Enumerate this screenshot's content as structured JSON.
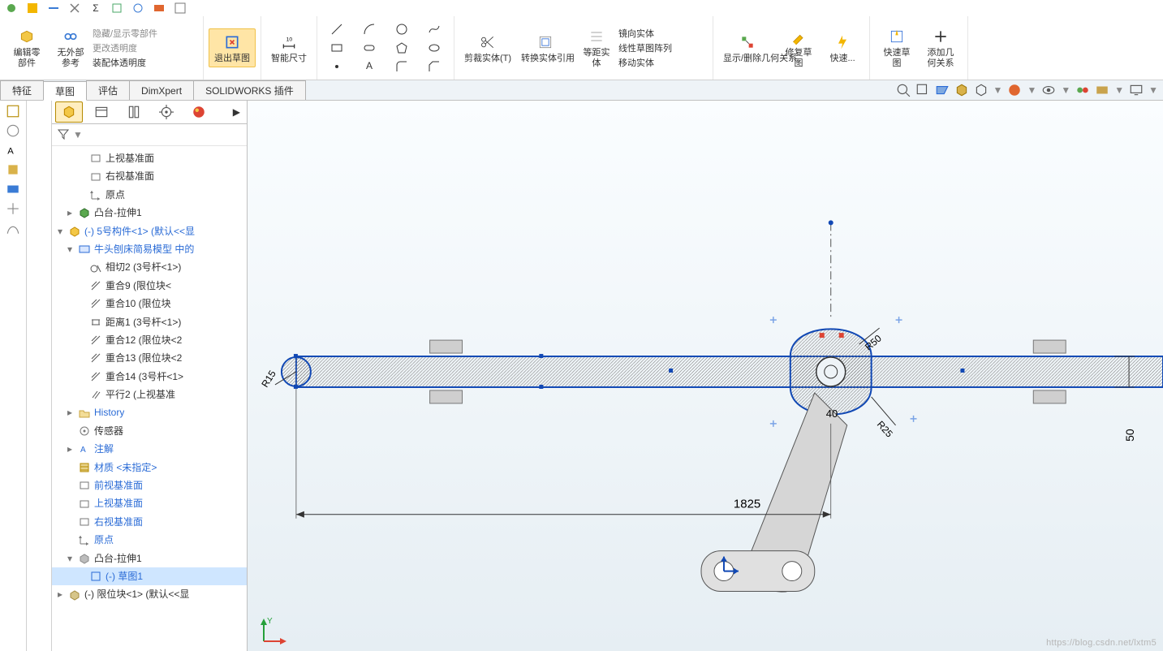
{
  "quickbar": {
    "icons": [
      "save",
      "undo",
      "redo",
      "rebuild",
      "options",
      "measure",
      "sigma",
      "capture",
      "layers",
      "cube",
      "link",
      "help"
    ]
  },
  "ribbon": {
    "edit_part_icon": "cube-edit",
    "edit_part": "编辑零\n部件",
    "ext_ref": "无外部\n参考",
    "row1": "隐藏/显示零部件",
    "row2": "更改透明度",
    "row3": "装配体透明度",
    "exit_sketch": "退出草图",
    "smart_dim": "智能尺寸",
    "trim": "剪裁实体(T)",
    "convert": "转换实体引用",
    "offset": "等距实\n体",
    "mirror": "镜向实体",
    "pattern": "线性草图阵列",
    "move": "移动实体",
    "relations": "显示/删除几何关系",
    "repair": "修复草\n图",
    "quick": "快速...",
    "quick_sketch": "快速草\n图",
    "add_relation": "添加几\n何关系"
  },
  "tabs": [
    "特征",
    "草图",
    "评估",
    "DimXpert",
    "SOLIDWORKS 插件"
  ],
  "hud_icons": [
    "zoom-fit",
    "zoom-area",
    "section",
    "view-cube",
    "orient",
    "appearance",
    "dd1",
    "hide-show",
    "render",
    "dd2",
    "display"
  ],
  "fp_tabs": [
    "assembly",
    "config",
    "display",
    "appearance",
    "render"
  ],
  "tree": [
    {
      "ind": 2,
      "icon": "plane",
      "label": "上视基准面",
      "blue": false
    },
    {
      "ind": 2,
      "icon": "plane",
      "label": "右视基准面",
      "blue": false
    },
    {
      "ind": 2,
      "icon": "origin",
      "label": "原点",
      "blue": false
    },
    {
      "ind": 1,
      "tw": "▸",
      "icon": "extrude",
      "label": "凸台-拉伸1",
      "blue": false
    },
    {
      "ind": 0,
      "tw": "▾",
      "icon": "part",
      "label": "(-) 5号构件<1> (默认<<显",
      "blue": true
    },
    {
      "ind": 1,
      "tw": "▾",
      "icon": "mates",
      "label": "牛头刨床简易模型 中的",
      "blue": true
    },
    {
      "ind": 2,
      "icon": "tangent",
      "label": "相切2 (3号杆<1>)",
      "blue": false
    },
    {
      "ind": 2,
      "icon": "coinc",
      "label": "重合9 (限位块<",
      "blue": false
    },
    {
      "ind": 2,
      "icon": "coinc",
      "label": "重合10 (限位块",
      "blue": false
    },
    {
      "ind": 2,
      "icon": "dist",
      "label": "距离1 (3号杆<1>)",
      "blue": false
    },
    {
      "ind": 2,
      "icon": "coinc",
      "label": "重合12 (限位块<2",
      "blue": false
    },
    {
      "ind": 2,
      "icon": "coinc",
      "label": "重合13 (限位块<2",
      "blue": false
    },
    {
      "ind": 2,
      "icon": "coinc",
      "label": "重合14 (3号杆<1>",
      "blue": false
    },
    {
      "ind": 2,
      "icon": "parallel",
      "label": "平行2 (上视基准",
      "blue": false
    },
    {
      "ind": 1,
      "tw": "▸",
      "icon": "folder",
      "label": "History",
      "blue": true
    },
    {
      "ind": 1,
      "icon": "sensor",
      "label": "传感器",
      "blue": false
    },
    {
      "ind": 1,
      "tw": "▸",
      "icon": "annot",
      "label": "注解",
      "blue": true
    },
    {
      "ind": 1,
      "icon": "material",
      "label": "材质 <未指定>",
      "blue": true
    },
    {
      "ind": 1,
      "icon": "plane",
      "label": "前视基准面",
      "blue": true
    },
    {
      "ind": 1,
      "icon": "plane",
      "label": "上视基准面",
      "blue": true
    },
    {
      "ind": 1,
      "icon": "plane",
      "label": "右视基准面",
      "blue": true
    },
    {
      "ind": 1,
      "icon": "origin",
      "label": "原点",
      "blue": true
    },
    {
      "ind": 1,
      "tw": "▾",
      "icon": "extrude-gray",
      "label": "凸台-拉伸1",
      "blue": false
    },
    {
      "ind": 2,
      "icon": "sketch",
      "label": "(-) 草图1",
      "blue": true,
      "selected": true
    },
    {
      "ind": 0,
      "tw": "▸",
      "icon": "part-gray",
      "label": "(-) 限位块<1> (默认<<显",
      "blue": false
    }
  ],
  "canvas": {
    "dim_length": "1825",
    "dim_r15": "R15",
    "dim_r25": "R25",
    "dim_50": "50",
    "dim_40": "40",
    "dim_r50": "R50",
    "watermark": "https://blog.csdn.net/lxtm5",
    "axis_y": "Y"
  }
}
